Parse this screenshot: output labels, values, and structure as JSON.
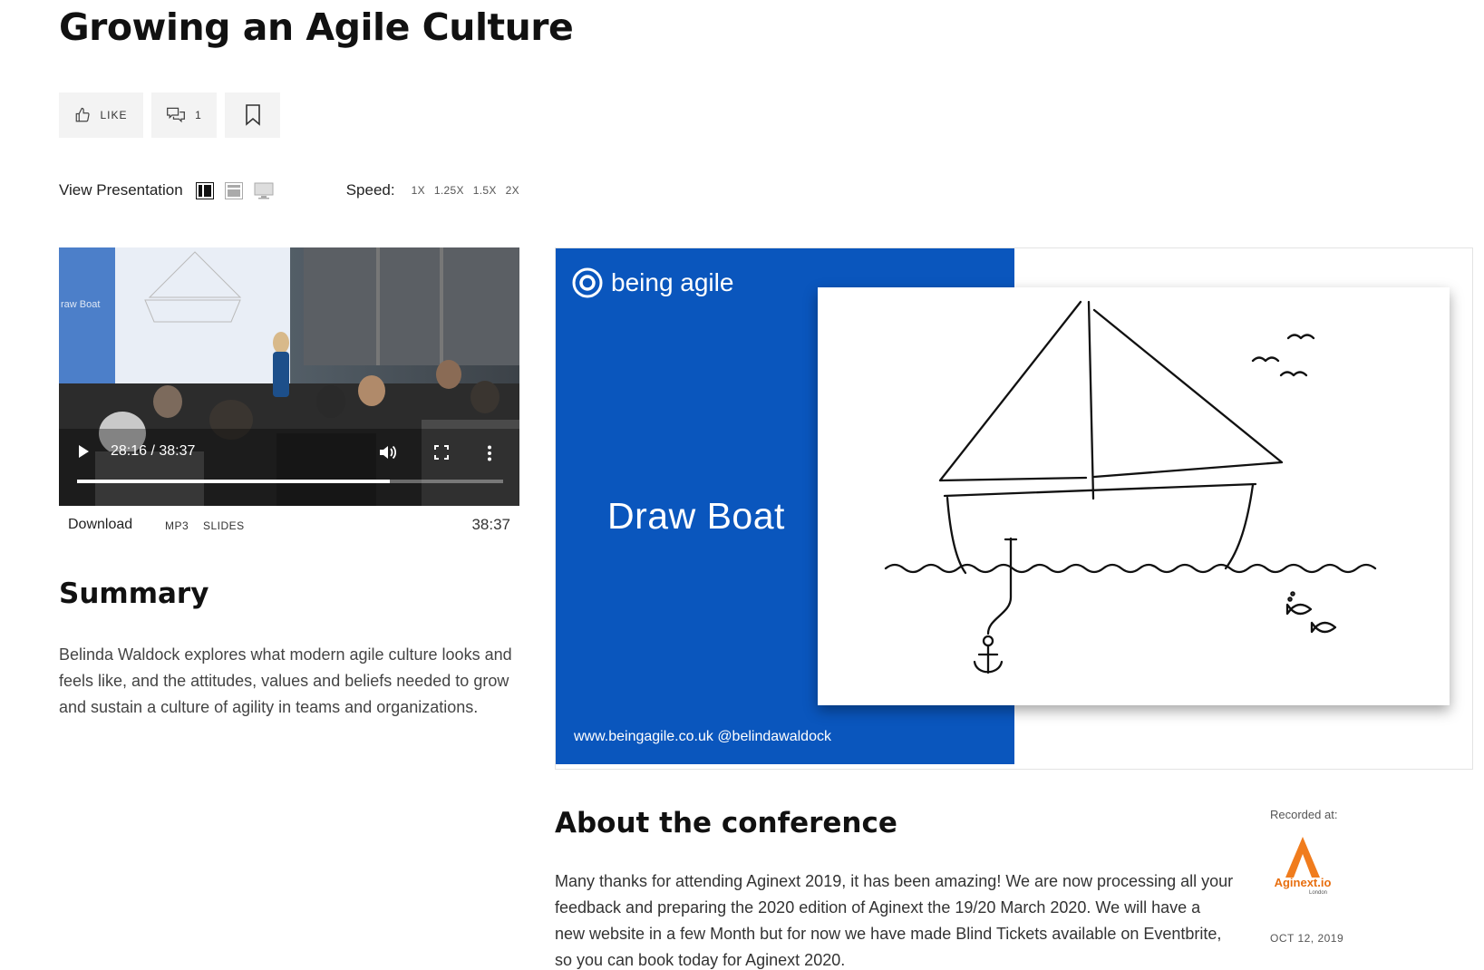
{
  "title": "Growing an Agile Culture",
  "actions": {
    "like_label": "LIKE",
    "comment_count": "1"
  },
  "view": {
    "label": "View Presentation",
    "speed_label": "Speed:",
    "speed_options": [
      "1X",
      "1.25X",
      "1.5X",
      "2X"
    ]
  },
  "video": {
    "time_display": "28:16 / 38:37",
    "progress": 0.733,
    "slide_text": "raw Boat"
  },
  "download": {
    "label": "Download",
    "mp3": "MP3",
    "slides": "SLIDES",
    "duration": "38:37"
  },
  "summary": {
    "heading": "Summary",
    "text": "Belinda Waldock explores what modern agile culture looks and feels like, and the attitudes, values and beliefs needed to grow and sustain a culture of agility in teams and organizations."
  },
  "slide": {
    "brand": "being agile",
    "title": "Draw Boat",
    "footer": "www.beingagile.co.uk  @belindawaldock",
    "brand_color": "#0a56bd"
  },
  "conference": {
    "heading": "About the conference",
    "text": "Many thanks for attending Aginext 2019, it has been amazing! We are now processing all your feedback and preparing the 2020 edition of Aginext the 19/20 March 2020. We will have a new website in a few Month but for now we have made Blind Tickets available on Eventbrite, so you can book today for Aginext 2020."
  },
  "recorded": {
    "label": "Recorded at:",
    "logo_text": "Aginext.io",
    "logo_sub": "London",
    "date": "OCT 12, 2019"
  },
  "icons": {
    "like": "thumbs-up-icon",
    "comment": "comment-icon",
    "bookmark": "bookmark-icon",
    "play": "play-icon",
    "volume": "volume-icon",
    "fullscreen": "fullscreen-icon",
    "more": "more-vertical-icon"
  },
  "colors": {
    "logo_orange": "#f07c1d"
  }
}
